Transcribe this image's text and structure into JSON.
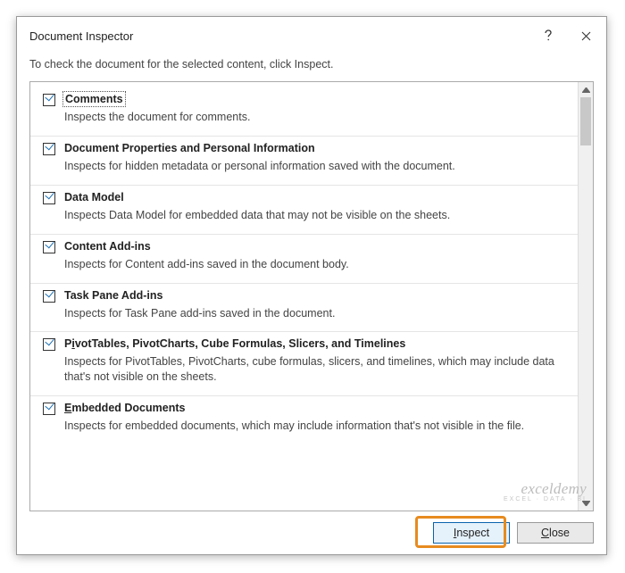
{
  "dialog": {
    "title": "Document Inspector",
    "subtext": "To check the document for the selected content, click Inspect."
  },
  "items": [
    {
      "title": "Comments",
      "desc": "Inspects the document for comments.",
      "focused": true,
      "sep": true
    },
    {
      "title": "Document Properties and Personal Information",
      "desc": "Inspects for hidden metadata or personal information saved with the document.",
      "sep": true
    },
    {
      "title": "Data Model",
      "desc": "Inspects Data Model for embedded data that may not be visible on the sheets.",
      "sep": true
    },
    {
      "title": "Content Add-ins",
      "desc": "Inspects for Content add-ins saved in the document body.",
      "sep": true
    },
    {
      "title": "Task Pane Add-ins",
      "desc": "Inspects for Task Pane add-ins saved in the document.",
      "sep": true
    },
    {
      "title_html": "P<span class='ul'>i</span>votTables, PivotCharts, Cube Formulas, Slicers, and Timelines",
      "desc": "Inspects for PivotTables, PivotCharts, cube formulas, slicers, and timelines, which may include data that's not visible on the sheets.",
      "sep": true
    },
    {
      "title_html": "<span class='ul'>E</span>mbedded Documents",
      "desc": "Inspects for embedded documents, which may include information that's not visible in the file.",
      "sep": false
    }
  ],
  "buttons": {
    "inspect_html": "<span class='ul'>I</span>nspect",
    "close_html": "<span class='ul'>C</span>lose"
  },
  "watermark": {
    "main": "exceldemy",
    "sub": "EXCEL · DATA · BI"
  }
}
